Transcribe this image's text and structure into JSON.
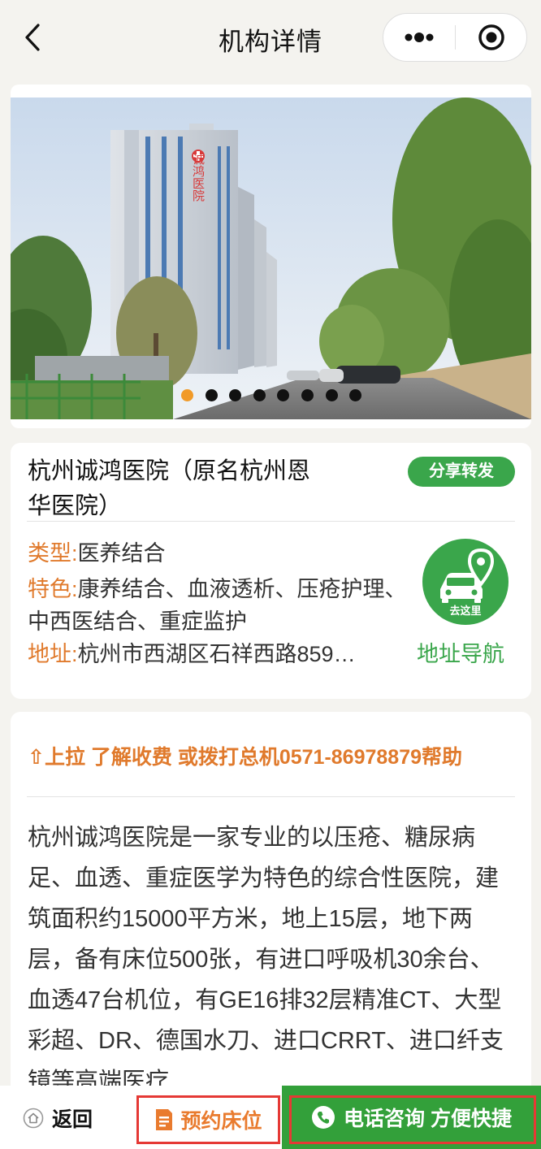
{
  "navbar": {
    "title": "机构详情"
  },
  "banner": {
    "slide_count": 8,
    "active_index": 0,
    "sign_text": "诚鸿医院",
    "colors": {
      "active_dot": "#f19a28",
      "dot": "#111111"
    }
  },
  "info": {
    "name": "杭州诚鸿医院（原名杭州恩华医院）",
    "share_label": "分享转发",
    "type_label": "类型:",
    "type_value": "医养结合",
    "feature_label": "特色:",
    "feature_value": "康养结合、血液透析、压疮护理、中西医结合、重症监护",
    "address_label": "地址:",
    "address_value": "杭州市西湖区石祥西路859…",
    "goto_label": "去这里",
    "nav_label": "地址导航"
  },
  "description": {
    "hint": "⇧上拉 了解收费 或拨打总机0571-86978879帮助",
    "text": "杭州诚鸿医院是一家专业的以压疮、糖尿病足、血透、重症医学为特色的综合性医院，建筑面积约15000平方米，地上15层，地下两层，备有床位500张，有进口呼吸机30余台、血透47台机位，有GE16排32层精准CT、大型彩超、DR、德国水刀、进口CRRT、进口纤支镜等高端医疗"
  },
  "bottom": {
    "back_label": "返回",
    "reserve_label": "预约床位",
    "call_label": "电话咨询 方便快捷"
  },
  "theme": {
    "accent_green": "#3aa64b",
    "accent_orange": "#e07a2c",
    "highlight_red": "#e53935"
  }
}
